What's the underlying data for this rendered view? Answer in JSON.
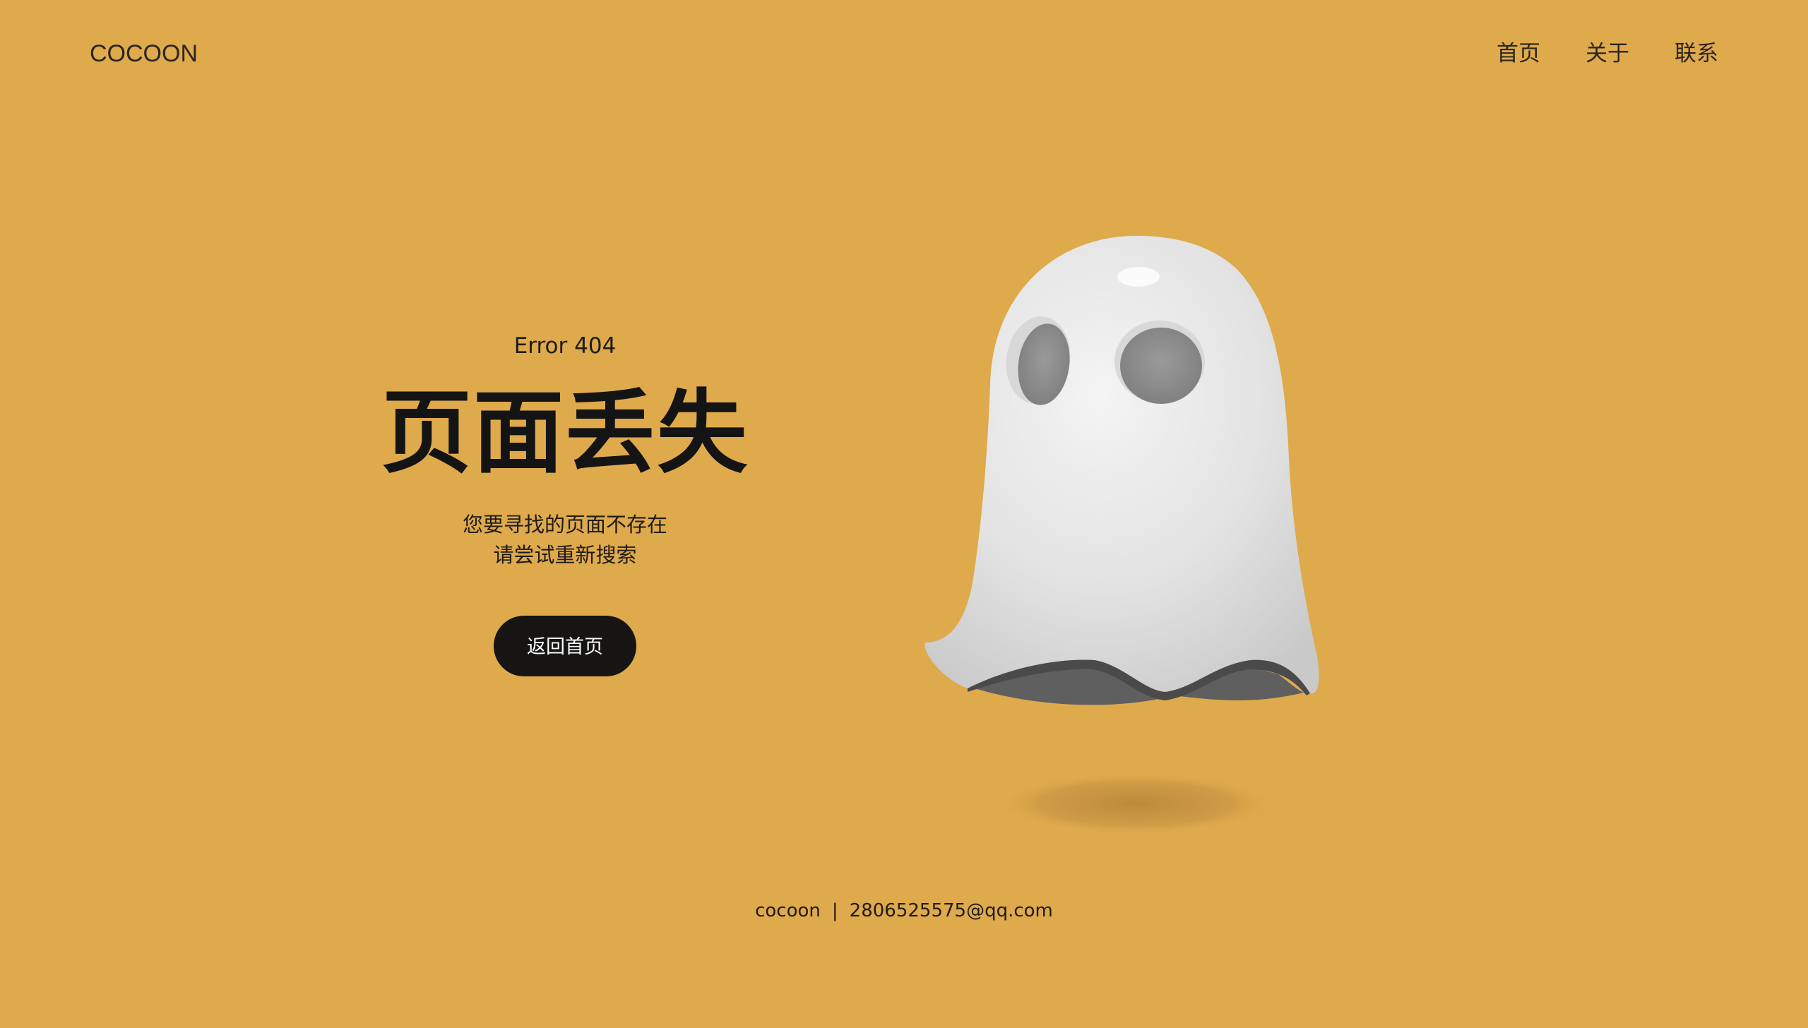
{
  "header": {
    "logo": "COCOON",
    "nav": [
      {
        "label": "首页"
      },
      {
        "label": "关于"
      },
      {
        "label": "联系"
      }
    ]
  },
  "hero": {
    "error_code": "Error 404",
    "title": "页面丢失",
    "description_line1": "您要寻找的页面不存在",
    "description_line2": "请尝试重新搜索",
    "button_label": "返回首页"
  },
  "illustration": {
    "icon": "ghost-icon"
  },
  "footer": {
    "name": "cocoon",
    "separator": "|",
    "email": "2806525575@qq.com"
  },
  "colors": {
    "background": "#DFAA4C",
    "button": "#161514",
    "text": "#1a1a1a"
  }
}
